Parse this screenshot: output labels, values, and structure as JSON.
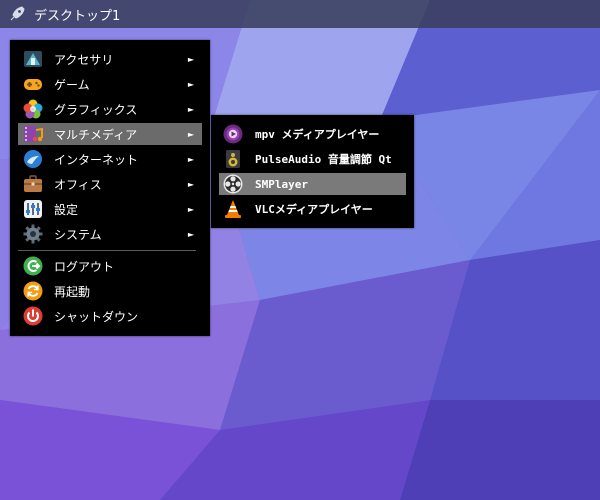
{
  "topbar": {
    "workspace_title": "デスクトップ1",
    "launcher_icon": "rocket-icon"
  },
  "main_menu": {
    "items": [
      {
        "label": "アクセサリ",
        "icon": "accessories-icon",
        "has_submenu": true
      },
      {
        "label": "ゲーム",
        "icon": "gamepad-icon",
        "has_submenu": true
      },
      {
        "label": "グラフィックス",
        "icon": "graphics-icon",
        "has_submenu": true
      },
      {
        "label": "マルチメディア",
        "icon": "multimedia-icon",
        "has_submenu": true,
        "active": true
      },
      {
        "label": "インターネット",
        "icon": "internet-icon",
        "has_submenu": true
      },
      {
        "label": "オフィス",
        "icon": "briefcase-icon",
        "has_submenu": true
      },
      {
        "label": "設定",
        "icon": "settings-icon",
        "has_submenu": true
      },
      {
        "label": "システム",
        "icon": "gear-icon",
        "has_submenu": true
      }
    ],
    "session_items": [
      {
        "label": "ログアウト",
        "icon": "logout-icon"
      },
      {
        "label": "再起動",
        "icon": "restart-icon"
      },
      {
        "label": "シャットダウン",
        "icon": "power-icon"
      }
    ],
    "arrow_glyph": "►"
  },
  "submenu": {
    "items": [
      {
        "label": "mpv メディアプレイヤー",
        "icon": "mpv-icon"
      },
      {
        "label": "PulseAudio 音量調節 Qt",
        "icon": "speaker-icon"
      },
      {
        "label": "SMPlayer",
        "icon": "smplayer-reel-icon",
        "active": true
      },
      {
        "label": "VLCメディアプレイヤー",
        "icon": "vlc-cone-icon"
      }
    ]
  },
  "colors": {
    "menu_bg": "#000000",
    "active_bg": "#6b6b6b",
    "topbar_bg": "#3a3f5e"
  }
}
